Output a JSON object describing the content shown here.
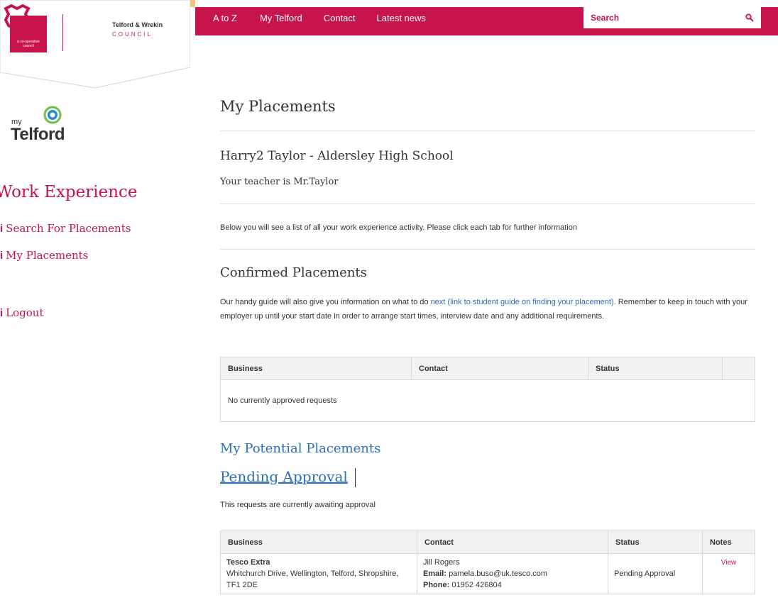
{
  "header": {
    "coop_logo_text": "a co-operative council",
    "council_name": "Telford & Wrekin",
    "council_sub": "COUNCIL",
    "nav": [
      "A to Z",
      "My Telford",
      "Contact",
      "Latest news"
    ],
    "search_placeholder": "Search"
  },
  "colors": {
    "brand": "#c7144b",
    "link_blue": "#2a6ebb"
  },
  "sidebar": {
    "logo_my": "my",
    "logo_telford": "Telford",
    "title": "Work Experience",
    "links": [
      {
        "icon": "i",
        "label": "Search For Placements"
      },
      {
        "icon": "i",
        "label": "My Placements"
      },
      {
        "icon": "i",
        "label": "Logout"
      }
    ]
  },
  "main": {
    "page_title": "My Placements",
    "student_heading": "Harry2 Taylor - Aldersley High School",
    "teacher_text": "Your teacher is Mr.Taylor",
    "intro_text": "Below you will see a list of all your work experience activity. Please click each tab for further information",
    "confirmed": {
      "heading": "Confirmed Placements",
      "guide_before": "Our handy guide will also give you information on what to do ",
      "guide_link": "next (link to student guide on finding your placement).",
      "guide_after": "Remember to keep in touch with your employer up until your start date in order to arrange start times, interview date and any additional requirements.",
      "columns": [
        "Business",
        "Contact",
        "Status",
        ""
      ],
      "empty_message": "No currently approved requests"
    },
    "potential": {
      "heading": "My Potential Placements",
      "pending_heading": "Pending Approval",
      "pending_text": "This requests are currently awaiting approval",
      "columns": [
        "Business",
        "Contact",
        "Status",
        "Notes"
      ],
      "rows": [
        {
          "business_name": "Tesco Extra",
          "business_address": "Whitchurch Drive, Wellington, Telford, Shropshire, TF1 2DE",
          "contact_name": "Jill Rogers",
          "email_label": "Email:",
          "email": "pamela.buso@uk.tesco.com",
          "phone_label": "Phone:",
          "phone": "01952 426804",
          "status": "Pending Approval",
          "notes_link": "View"
        }
      ]
    }
  }
}
